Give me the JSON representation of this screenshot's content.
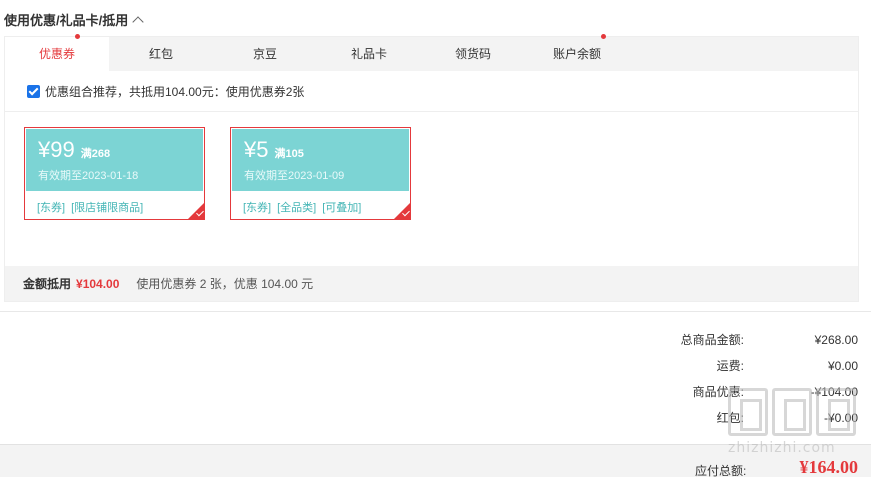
{
  "section": {
    "title": "使用优惠/礼品卡/抵用"
  },
  "tabs": [
    {
      "label": "优惠券",
      "active": true,
      "dot": true
    },
    {
      "label": "红包",
      "active": false,
      "dot": false
    },
    {
      "label": "京豆",
      "active": false,
      "dot": false
    },
    {
      "label": "礼品卡",
      "active": false,
      "dot": false
    },
    {
      "label": "领货码",
      "active": false,
      "dot": false
    },
    {
      "label": "账户余额",
      "active": false,
      "dot": true
    }
  ],
  "combo": {
    "checked": true,
    "text": "优惠组合推荐，共抵用104.00元：使用优惠券2张"
  },
  "coupons": [
    {
      "amount": "¥99",
      "condition": "满268",
      "valid": "有效期至2023-01-18",
      "tags": [
        "[东券]",
        "[限店铺限商品]"
      ]
    },
    {
      "amount": "¥5",
      "condition": "满105",
      "valid": "有效期至2023-01-09",
      "tags": [
        "[东券]",
        "[全品类]",
        "[可叠加]"
      ]
    }
  ],
  "summary": {
    "label": "金额抵用",
    "amount": "¥104.00",
    "desc": "使用优惠券 2 张，优惠 104.00 元"
  },
  "totals": [
    {
      "label": "总商品金额:",
      "value": "¥268.00"
    },
    {
      "label": "运费:",
      "value": "¥0.00"
    },
    {
      "label": "商品优惠:",
      "value": "-¥104.00"
    },
    {
      "label": "红包:",
      "value": "-¥0.00"
    }
  ],
  "payable": {
    "label": "应付总额:",
    "amount": "¥164.00"
  },
  "watermark": {
    "text": "zhizhizhi.com"
  },
  "colors": {
    "accent": "#e4393c",
    "coupon": "#7cd4d4",
    "tag": "#43b5b5",
    "checkbox": "#1a73e8"
  }
}
